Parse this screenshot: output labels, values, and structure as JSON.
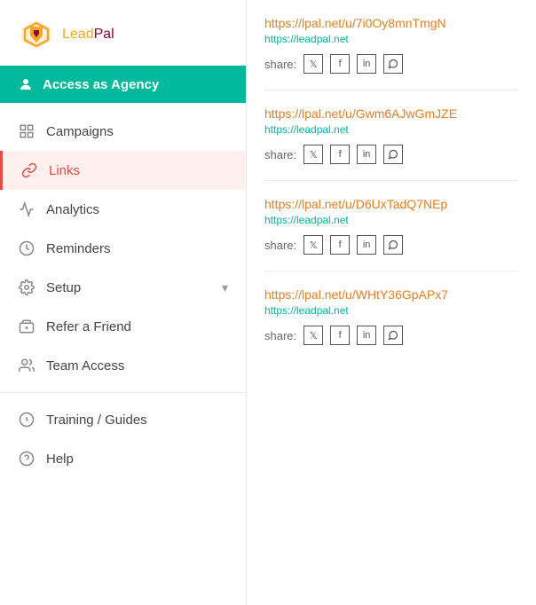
{
  "logo": {
    "lead": "Lead",
    "pal": "Pal"
  },
  "access_bar": {
    "label": "Access as Agency"
  },
  "nav": {
    "items": [
      {
        "id": "campaigns",
        "label": "Campaigns",
        "active": false
      },
      {
        "id": "links",
        "label": "Links",
        "active": true
      },
      {
        "id": "analytics",
        "label": "Analytics",
        "active": false
      },
      {
        "id": "reminders",
        "label": "Reminders",
        "active": false
      },
      {
        "id": "setup",
        "label": "Setup",
        "active": false,
        "has_chevron": true
      },
      {
        "id": "refer",
        "label": "Refer a Friend",
        "active": false
      },
      {
        "id": "team",
        "label": "Team Access",
        "active": false
      },
      {
        "id": "training",
        "label": "Training / Guides",
        "active": false
      },
      {
        "id": "help",
        "label": "Help",
        "active": false
      }
    ]
  },
  "links": [
    {
      "primary": "https://lpal.net/u/7i0Oy8mnTmgN",
      "secondary": "https://leadpal.net"
    },
    {
      "primary": "https://lpal.net/u/Gwm6AJwGmJZE",
      "secondary": "https://leadpal.net"
    },
    {
      "primary": "https://lpal.net/u/D6UxTadQ7NEp",
      "secondary": "https://leadpal.net"
    },
    {
      "primary": "https://lpal.net/u/WHtY36GpAPx7",
      "secondary": "https://leadpal.net"
    }
  ],
  "share_label": "share:",
  "colors": {
    "teal": "#00b89c",
    "orange": "#e67e22",
    "red": "#e74c3c",
    "logo_orange": "#f5a623",
    "logo_dark": "#8b0033"
  }
}
